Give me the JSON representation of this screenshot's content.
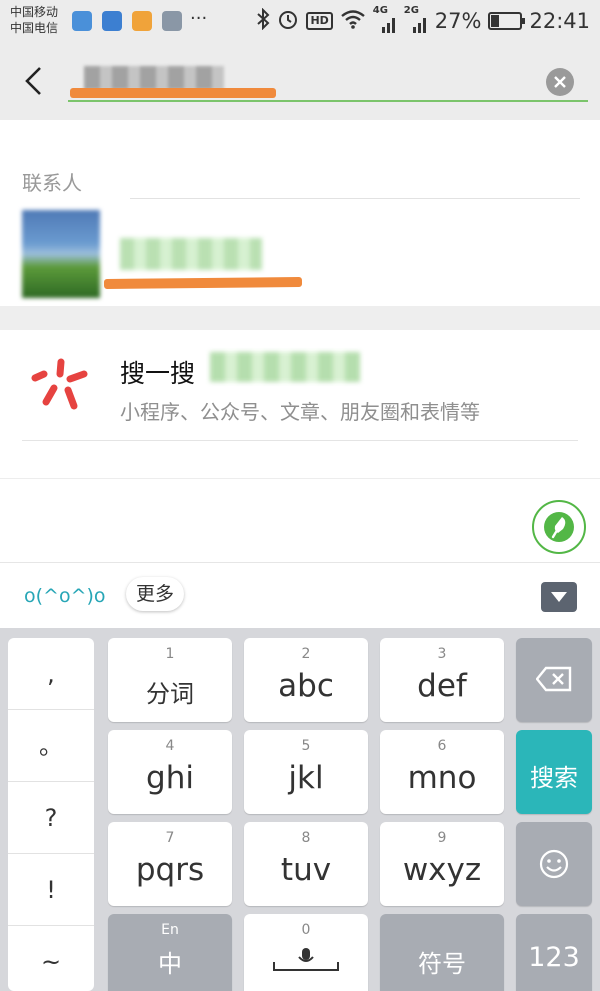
{
  "status_bar": {
    "carrier_1": "中国移动",
    "carrier_2": "中国电信",
    "more": "···",
    "hd": "HD",
    "net_4g": "4G",
    "net_2g": "2G",
    "battery_text": "27%",
    "battery_level": 0.27,
    "time": "22:41"
  },
  "search": {
    "query": ""
  },
  "contacts": {
    "title": "联系人"
  },
  "sousou": {
    "title": "搜一搜",
    "subtitle": "小程序、公众号、文章、朋友圈和表情等",
    "logo_color": "#e64340"
  },
  "candidates": {
    "kaomoji": "o(^o^)o",
    "more": "更多"
  },
  "keyboard": {
    "punctuation": [
      ",",
      "。",
      "?",
      "!",
      "~"
    ],
    "keys": [
      {
        "num": "1",
        "label": "分词"
      },
      {
        "num": "2",
        "label": "abc"
      },
      {
        "num": "3",
        "label": "def"
      },
      {
        "num": "4",
        "label": "ghi"
      },
      {
        "num": "5",
        "label": "jkl"
      },
      {
        "num": "6",
        "label": "mno"
      },
      {
        "num": "7",
        "label": "pqrs"
      },
      {
        "num": "8",
        "label": "tuv"
      },
      {
        "num": "9",
        "label": "wxyz"
      }
    ],
    "search_key": "搜索",
    "lang_top": "En",
    "lang_main": "中",
    "zero": "0",
    "symbols": "符号",
    "numbers": "123"
  },
  "colors": {
    "accent_green": "#53b746",
    "search_key_teal": "#2bb6b9",
    "redaction_orange": "#f08a3c"
  }
}
